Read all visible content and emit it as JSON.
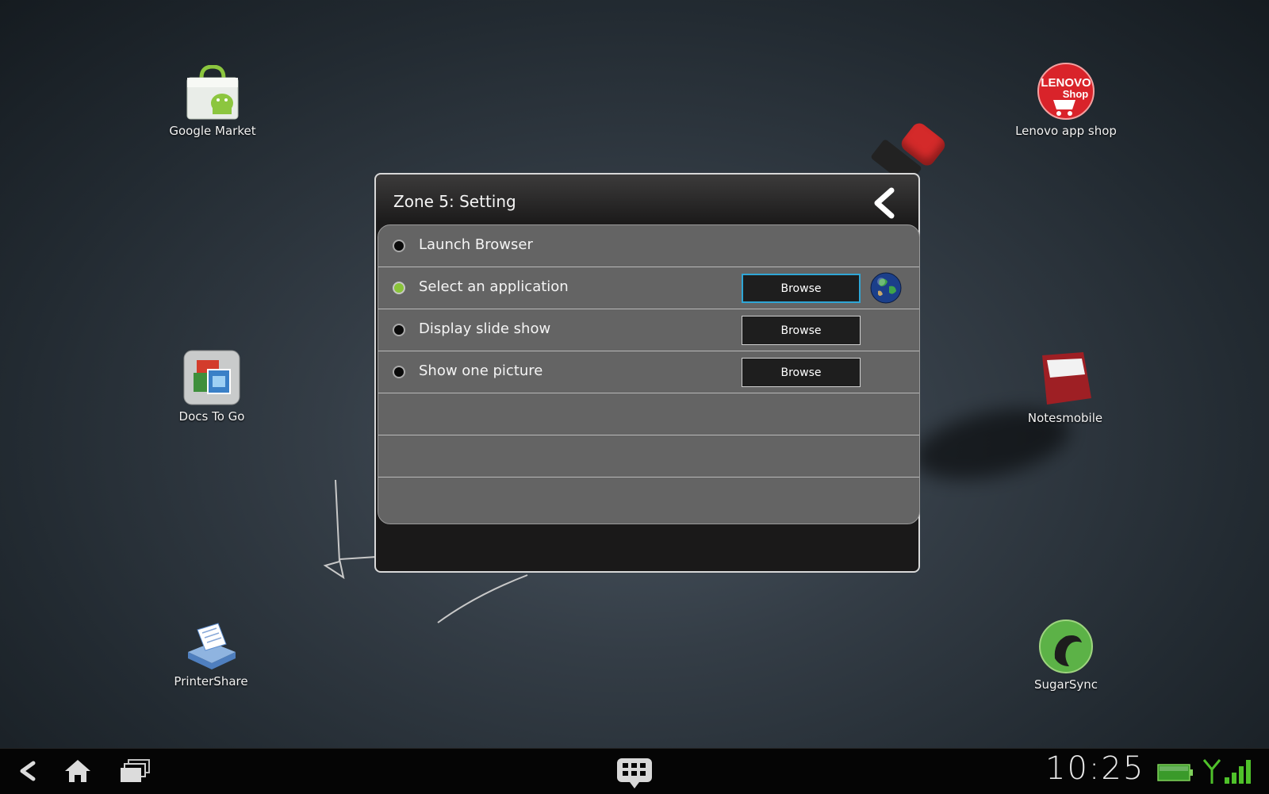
{
  "desktop": {
    "icons": [
      {
        "label": "Google Market",
        "icon": "market-bag-icon"
      },
      {
        "label": "Lenovo app shop",
        "icon": "lenovo-shop-icon",
        "logo_text_1": "LENOVO",
        "logo_text_2": "Shop"
      },
      {
        "label": "Docs To Go",
        "icon": "docs-to-go-icon"
      },
      {
        "label": "Notesmobile",
        "icon": "notes-icon"
      },
      {
        "label": "PrinterShare",
        "icon": "printer-icon"
      },
      {
        "label": "SugarSync",
        "icon": "sugarsync-icon"
      }
    ]
  },
  "dialog": {
    "title": "Zone 5: Setting",
    "back_icon": "chevron-left-icon",
    "options": [
      {
        "label": "Launch Browser",
        "checked": false
      },
      {
        "label": "Select an application",
        "checked": true,
        "browse_label": "Browse",
        "selected_app_icon": "globe-icon"
      },
      {
        "label": "Display slide show",
        "checked": false,
        "browse_label": "Browse"
      },
      {
        "label": "Show one picture",
        "checked": false,
        "browse_label": "Browse"
      }
    ]
  },
  "navbar": {
    "back_icon": "back-icon",
    "home_icon": "home-icon",
    "recents_icon": "recent-apps-icon",
    "keyboard_icon": "keyboard-icon",
    "clock": "10:25",
    "battery_icon": "battery-icon",
    "signal_icon": "signal-icon"
  },
  "colors": {
    "accent_green": "#8ac43a",
    "focus_blue": "#2fa6d6"
  }
}
